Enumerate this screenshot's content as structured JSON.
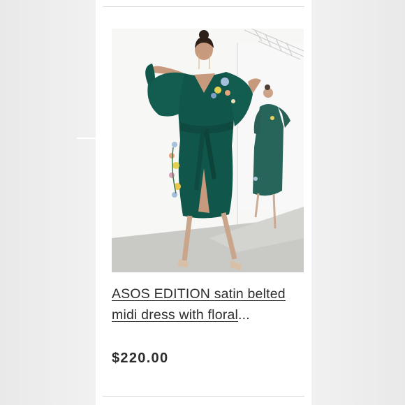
{
  "product": {
    "title_line1": "ASOS EDITION satin belted",
    "title_line2": "midi dress with floral",
    "title_ellipsis": "...",
    "price": "$220.00"
  },
  "colors": {
    "dress": "#11564a",
    "card_background": "#ffffff",
    "page_background": "#eeeeee",
    "text": "#2d2d2d"
  }
}
